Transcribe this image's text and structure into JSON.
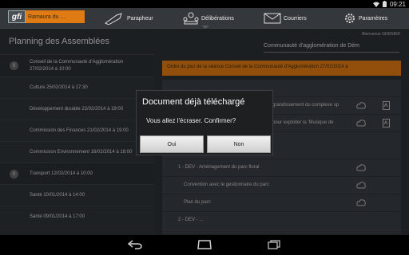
{
  "status_bar": {
    "time": "09:21",
    "icons": [
      "wifi-icon",
      "battery-icon"
    ]
  },
  "top_nav": {
    "logo_text": "gfi",
    "logo_subtext": "Ramaura du ...",
    "items": [
      {
        "label": "Parapheur",
        "icon": "pen-icon"
      },
      {
        "label": "Délibérations",
        "icon": "assembly-icon"
      },
      {
        "label": "Courriers",
        "icon": "envelope-icon"
      },
      {
        "label": "Paramètres",
        "icon": "gear-icon"
      }
    ]
  },
  "left_panel": {
    "title": "Planning des Assemblées",
    "items": [
      {
        "badge": "0",
        "text": "Conseil de la Communauté d'Agglomération\n27/02/2014 à 10:00",
        "group": true
      },
      {
        "text": "Culture 25/02/2014 à 17:30"
      },
      {
        "text": "Développement durable 22/02/2014 à 19:00"
      },
      {
        "text": "Commission des Finances 21/02/2014 à 19:00"
      },
      {
        "text": "Commission Environnement 16/02/2014 à 18:00"
      },
      {
        "badge": "0",
        "text": "Transport 12/02/2014 à 10:00",
        "group": true
      },
      {
        "text": "Santé 10/01/2014 à 14:00"
      },
      {
        "text": "Santé 09/01/2014 à 17:00"
      }
    ]
  },
  "right_panel": {
    "user": "Bienvenue GRENIER",
    "collectivity": "Communauté d'agglomération de Dém",
    "banner": "Ordre du jour de la séance Conseil de la Communauté d'Agglomération 27/02/2014 à",
    "rows": [
      {
        "text": "",
        "indent": 10
      },
      {
        "text": "grandissement du complexe sp",
        "indent": 138,
        "pdf": true
      },
      {
        "text": "pour exploiter la 'Musique de",
        "indent": 138,
        "pdf": true
      },
      {
        "text": "",
        "indent": 10
      },
      {
        "text": "1 - DEV - Aménagement du parc floral",
        "indent": 20
      },
      {
        "text": "Convention avec le gestionnaire du parc",
        "indent": 27
      },
      {
        "text": "Plan du parc",
        "indent": 27
      },
      {
        "text": "2 - DEV - ...",
        "indent": 20
      }
    ]
  },
  "dialog": {
    "title": "Document déjà téléchargé",
    "message": "Vous allez l'écraser. Confirmer?",
    "confirm_label": "Oui",
    "cancel_label": "Non"
  },
  "colors": {
    "accent": "#e07a12",
    "background": "#2b3035"
  }
}
